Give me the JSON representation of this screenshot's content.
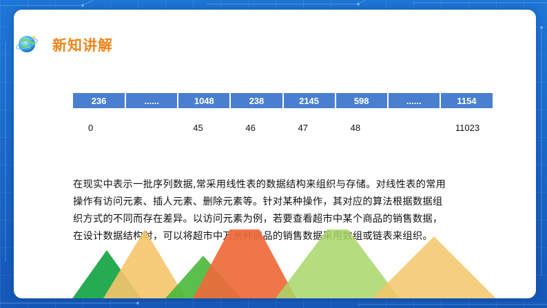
{
  "slide": {
    "title": "新知讲解"
  },
  "array": {
    "values": [
      "236",
      "......",
      "1048",
      "238",
      "2145",
      "598",
      "......",
      "1154"
    ],
    "indices": [
      "0",
      "",
      "45",
      "46",
      "47",
      "48",
      "",
      "11023"
    ]
  },
  "paragraph": {
    "lines": [
      "在现实中表示一批序列数据,常采用线性表的数据结构来组织与存储。对线性表的常用",
      "操作有访问元素、插人元素、删除元素等。针对某种操作，其对应的算法根据数据组",
      "织方式的不同而存在差异。以访问元素为例，若要查看超市中某个商品的销售数据，",
      "在设计数据结构时，可以将超市中万余种商品的销售数据采用数组或链表来组织。"
    ]
  },
  "colors": {
    "accent": "#f08419",
    "table_header": "#4a7fd0",
    "background": "#1a63c9"
  },
  "icons": {
    "title_icon": "globe-icon"
  }
}
